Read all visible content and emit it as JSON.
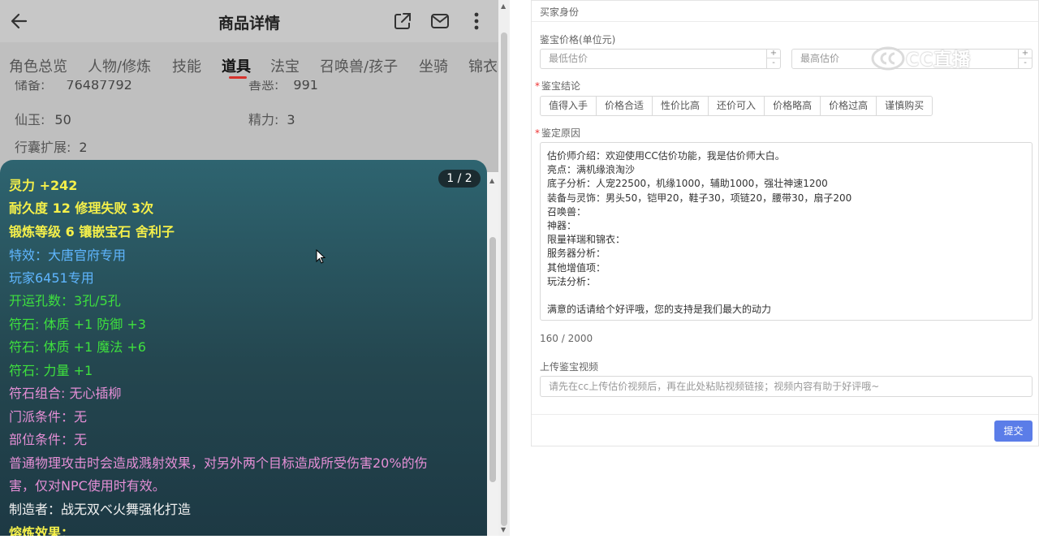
{
  "header": {
    "title": "商品详情"
  },
  "tabs": [
    "角色总览",
    "人物/修炼",
    "技能",
    "道具",
    "法宝",
    "召唤兽/孩子",
    "坐骑",
    "锦衣"
  ],
  "active_tab": "道具",
  "stats": {
    "partial_left_label": "储备:",
    "partial_left_value": "76487792",
    "partial_right_label": "善恶:",
    "partial_right_value": "991",
    "xianyu_label": "仙玉:",
    "xianyu_value": "50",
    "jingli_label": "精力:",
    "jingli_value": "3",
    "bag_label": "行囊扩展:",
    "bag_value": "2"
  },
  "tooltip": {
    "pager": "1 / 2",
    "lines": [
      "灵力 +242",
      "耐久度 12 修理失败 3次",
      "锻炼等级 6 镶嵌宝石 舍利子",
      "特效：大唐官府专用",
      "玩家6451专用",
      "开运孔数：3孔/5孔",
      "符石: 体质 +1 防御 +3",
      "符石: 体质 +1 魔法 +6",
      "符石: 力量 +1",
      "符石组合: 无心插柳",
      "门派条件：无",
      "部位条件：无",
      "普通物理攻击时会造成溅射效果，对另外两个目标造成所受伤害20%的伤",
      "害，仅对NPC使用时有效。",
      "制造者：战无双ベ火舞强化打造",
      "熔炼效果："
    ]
  },
  "form": {
    "section_title": "买家身份",
    "price_label": "鉴宝价格(单位元)",
    "min_placeholder": "最低估价",
    "max_placeholder": "最高估价",
    "conclusion_label": "鉴宝结论",
    "conclusions": [
      "值得入手",
      "价格合适",
      "性价比高",
      "还价可入",
      "价格略高",
      "价格过高",
      "谨慎购买"
    ],
    "reason_label": "鉴定原因",
    "reason_lines": [
      "估价师介绍：欢迎使用CC估价功能，我是估价师大白。",
      "亮点：满机缘浪淘沙",
      "底子分析：人宠22500，机缘1000，辅助1000，强壮神速1200",
      "装备与灵饰：男头50，铠甲20，鞋子30，项链20，腰带30，扇子200",
      "召唤兽：",
      "神器：",
      "限量祥瑞和锦衣：",
      "服务器分析：",
      "其他增值项：",
      "玩法分析：",
      "",
      "满意的话请给个好评哦，您的支持是我们最大的动力"
    ],
    "char_count": "160 / 2000",
    "video_label": "上传鉴宝视频",
    "video_placeholder": "请先在cc上传估价视频后，再在此处粘贴视频链接；视频内容有助于好评哦~",
    "submit_label": "提交",
    "required_mark": "*"
  },
  "watermark": "CC直播"
}
